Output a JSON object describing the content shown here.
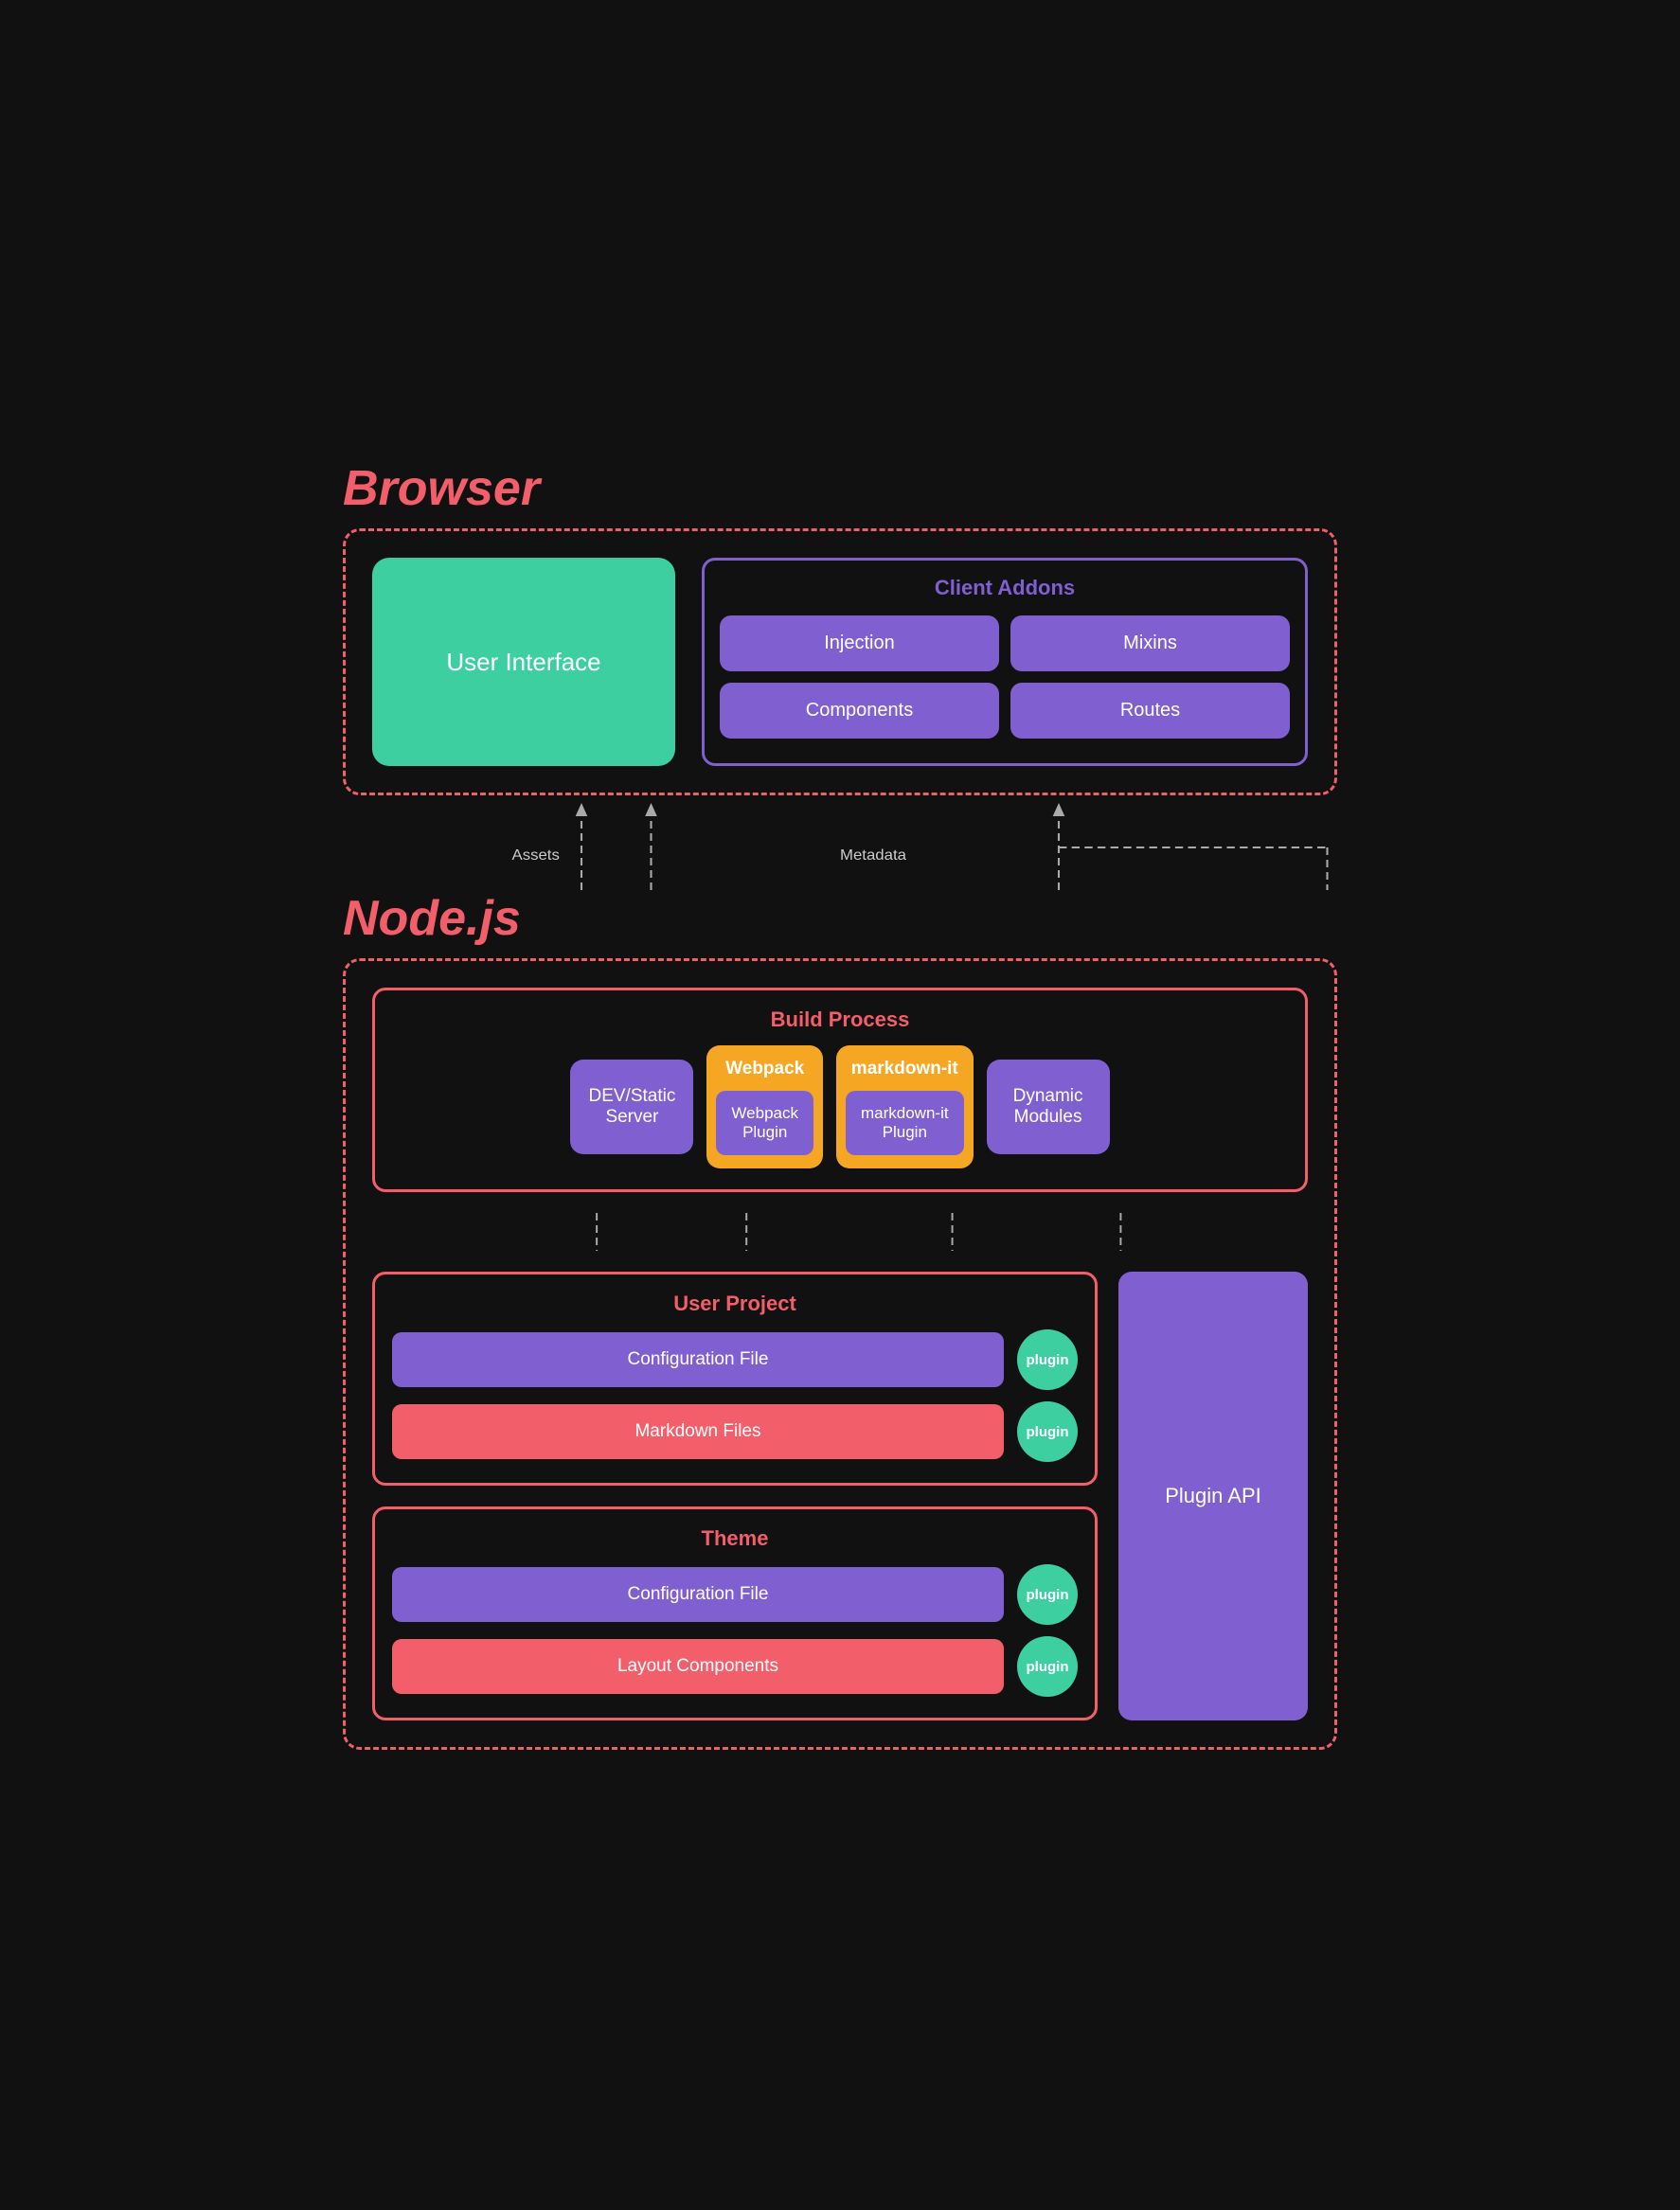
{
  "browser": {
    "label": "Browser",
    "ui_box": "User Interface",
    "client_addons": {
      "title": "Client Addons",
      "items": [
        {
          "label": "Injection"
        },
        {
          "label": "Mixins"
        },
        {
          "label": "Components"
        },
        {
          "label": "Routes"
        }
      ]
    }
  },
  "connectors": {
    "assets_label": "Assets",
    "metadata_label": "Metadata"
  },
  "nodejs": {
    "label": "Node.js",
    "build_process": {
      "title": "Build Process",
      "items": [
        {
          "label": "DEV/Static\nServer",
          "type": "purple"
        },
        {
          "type": "webpack-group",
          "top": "Webpack",
          "inner": "Webpack\nPlugin"
        },
        {
          "type": "markdown-group",
          "top": "markdown-it",
          "inner": "markdown-it\nPlugin"
        },
        {
          "label": "Dynamic\nModules",
          "type": "purple"
        }
      ]
    },
    "user_project": {
      "title": "User Project",
      "rows": [
        {
          "item": "Configuration File",
          "item_type": "purple",
          "plugin_label": "plugin"
        },
        {
          "item": "Markdown Files",
          "item_type": "red",
          "plugin_label": "plugin"
        }
      ]
    },
    "theme": {
      "title": "Theme",
      "rows": [
        {
          "item": "Configuration File",
          "item_type": "purple",
          "plugin_label": "plugin"
        },
        {
          "item": "Layout Components",
          "item_type": "red",
          "plugin_label": "plugin"
        }
      ]
    },
    "plugin_api": {
      "label": "Plugin API"
    }
  }
}
